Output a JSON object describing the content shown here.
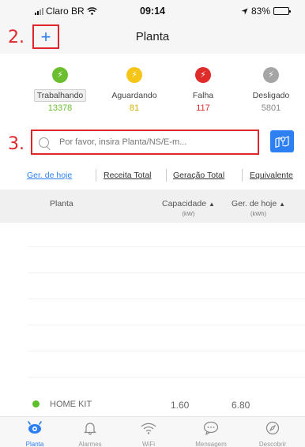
{
  "status_bar": {
    "carrier": "Claro BR",
    "time": "09:14",
    "battery": "83%",
    "battery_level": 0.83
  },
  "header": {
    "title": "Planta",
    "add_label": "+"
  },
  "callouts": {
    "add": "2.",
    "search": "3."
  },
  "status_summary": [
    {
      "label": "Trabalhando",
      "count": "13378",
      "color": "#6bbf2f",
      "count_color": "#6bbf2f",
      "icon": "lightning-icon"
    },
    {
      "label": "Aguardando",
      "count": "81",
      "color": "#f5c518",
      "count_color": "#d4b000",
      "icon": "lightning-icon"
    },
    {
      "label": "Falha",
      "count": "117",
      "color": "#e02b2b",
      "count_color": "#e02b2b",
      "icon": "lightning-icon"
    },
    {
      "label": "Desligado",
      "count": "5801",
      "color": "#a5a5a5",
      "count_color": "#888888",
      "icon": "lightning-icon"
    }
  ],
  "search": {
    "placeholder": "Por favor, insira Planta/NS/E-m...",
    "value": ""
  },
  "sort_tabs": [
    "Ger. de hoje",
    "Receita Total",
    "Geração Total",
    "Equivalente"
  ],
  "table": {
    "headers": {
      "plant": "Planta",
      "capacity": "Capacidade",
      "capacity_unit": "(kW)",
      "today": "Ger. de hoje",
      "today_unit": "(kWh)"
    },
    "rows": [
      {
        "name": "HOME KIT",
        "capacity": "1.60",
        "today": "6.80",
        "status_color": "#5cbf2a"
      }
    ]
  },
  "bottom_tabs": [
    {
      "label": "Planta",
      "icon": "plant-eye-icon",
      "active": true
    },
    {
      "label": "Alarmes",
      "icon": "bell-icon",
      "active": false
    },
    {
      "label": "WiFi",
      "icon": "wifi-icon",
      "active": false
    },
    {
      "label": "Mensagem",
      "icon": "message-icon",
      "active": false
    },
    {
      "label": "Descobrir",
      "icon": "compass-icon",
      "active": false
    }
  ],
  "colors": {
    "accent": "#2d7ff2",
    "annotation": "#e0262b"
  }
}
